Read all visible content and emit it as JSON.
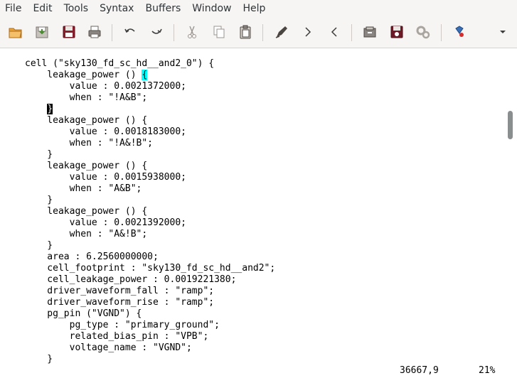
{
  "menubar": {
    "items": [
      "File",
      "Edit",
      "Tools",
      "Syntax",
      "Buffers",
      "Window",
      "Help"
    ]
  },
  "toolbar": {
    "buttons": [
      {
        "name": "open-icon"
      },
      {
        "name": "save-icon"
      },
      {
        "name": "save-all-icon"
      },
      {
        "name": "print-icon"
      },
      {
        "name": "undo-icon"
      },
      {
        "name": "redo-icon"
      },
      {
        "name": "cut-icon"
      },
      {
        "name": "copy-icon"
      },
      {
        "name": "paste-icon"
      },
      {
        "name": "find-replace-icon"
      },
      {
        "name": "find-next-icon"
      },
      {
        "name": "find-previous-icon"
      },
      {
        "name": "load-session-icon"
      },
      {
        "name": "save-session-icon"
      },
      {
        "name": "run-script-icon"
      },
      {
        "name": "make-icon"
      },
      {
        "name": "overflow-menu-icon"
      }
    ]
  },
  "editor": {
    "lines": [
      "cell (\"sky130_fd_sc_hd__and2_0\") {",
      "    leakage_power () {",
      "        value : 0.0021372000;",
      "        when : \"!A&B\";",
      "    }",
      "    leakage_power () {",
      "        value : 0.0018183000;",
      "        when : \"!A&!B\";",
      "    }",
      "    leakage_power () {",
      "        value : 0.0015938000;",
      "        when : \"A&B\";",
      "    }",
      "    leakage_power () {",
      "        value : 0.0021392000;",
      "        when : \"A&!B\";",
      "    }",
      "    area : 6.2560000000;",
      "    cell_footprint : \"sky130_fd_sc_hd__and2\";",
      "    cell_leakage_power : 0.0019221380;",
      "    driver_waveform_fall : \"ramp\";",
      "    driver_waveform_rise : \"ramp\";",
      "    pg_pin (\"VGND\") {",
      "        pg_type : \"primary_ground\";",
      "        related_bias_pin : \"VPB\";",
      "        voltage_name : \"VGND\";",
      "    }"
    ],
    "cursor_line_index": 4,
    "matching_bracket_line_index": 1
  },
  "statusbar": {
    "position": "36667,9",
    "percent": "21%"
  },
  "colors": {
    "chrome": "#f6f5f4",
    "cursor": "#000000",
    "bracket_match": "#00ffff",
    "text": "#000000"
  }
}
